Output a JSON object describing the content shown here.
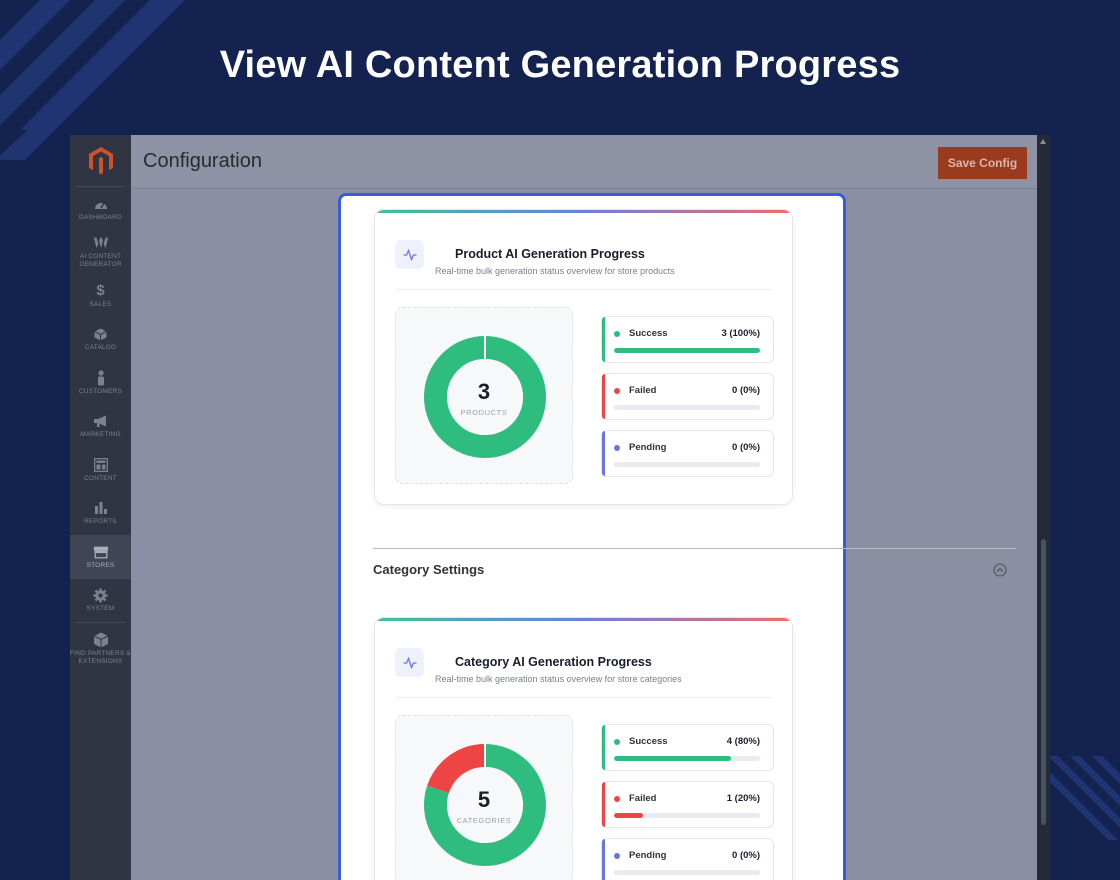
{
  "banner": {
    "title": "View AI Content Generation Progress"
  },
  "colors": {
    "success": "#2fbc7f",
    "failed": "#ee4444",
    "pending": "#6b74e0",
    "accent": "#3b5bdb",
    "save": "#9a3b1e"
  },
  "sidebar": {
    "items": [
      {
        "label": "DASHBOARD",
        "icon": "dashboard-icon"
      },
      {
        "label": "AI CONTENT GENERATOR",
        "icon": "ai-content-icon"
      },
      {
        "label": "SALES",
        "icon": "dollar-icon"
      },
      {
        "label": "CATALOG",
        "icon": "box-icon"
      },
      {
        "label": "CUSTOMERS",
        "icon": "person-icon"
      },
      {
        "label": "MARKETING",
        "icon": "megaphone-icon"
      },
      {
        "label": "CONTENT",
        "icon": "layout-icon"
      },
      {
        "label": "REPORTS",
        "icon": "bar-chart-icon"
      },
      {
        "label": "STORES",
        "icon": "store-icon"
      },
      {
        "label": "SYSTEM",
        "icon": "gear-icon"
      },
      {
        "label": "FIND PARTNERS & EXTENSIONS",
        "icon": "cube-icon"
      }
    ]
  },
  "header": {
    "title": "Configuration",
    "save_label": "Save Config"
  },
  "product_card": {
    "title": "Product AI Generation Progress",
    "subtitle": "Real-time bulk generation status overview for store products",
    "total": "3",
    "unit": "PRODUCTS",
    "stats": [
      {
        "label": "Success",
        "value": "3 (100%)",
        "fraction": 1.0
      },
      {
        "label": "Failed",
        "value": "0 (0%)",
        "fraction": 0.0
      },
      {
        "label": "Pending",
        "value": "0 (0%)",
        "fraction": 0.0
      }
    ]
  },
  "category_section": {
    "title": "Category Settings"
  },
  "category_card": {
    "title": "Category AI Generation Progress",
    "subtitle": "Real-time bulk generation status overview for store categories",
    "total": "5",
    "unit": "CATEGORIES",
    "stats": [
      {
        "label": "Success",
        "value": "4 (80%)",
        "fraction": 0.8
      },
      {
        "label": "Failed",
        "value": "1 (20%)",
        "fraction": 0.2
      },
      {
        "label": "Pending",
        "value": "0 (0%)",
        "fraction": 0.0
      }
    ]
  }
}
